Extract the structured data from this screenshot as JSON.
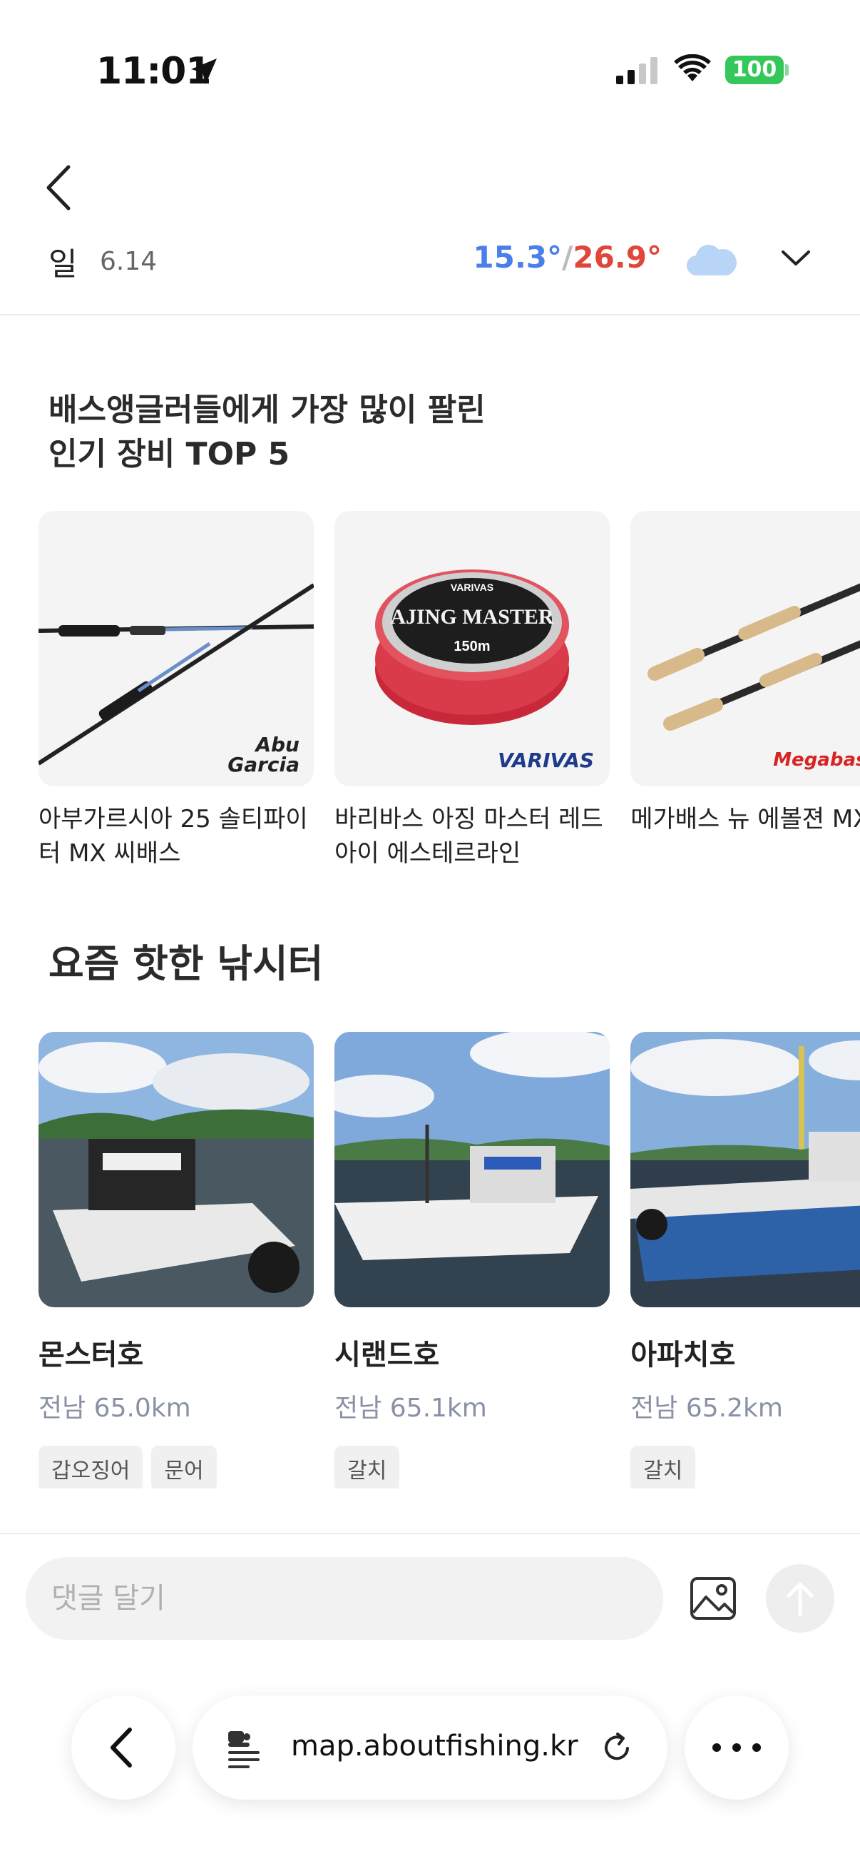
{
  "status_bar": {
    "time": "11:01",
    "battery": "100"
  },
  "weather": {
    "day": "일",
    "date": "6.14",
    "temp_low": "15.3°",
    "temp_separator": "/",
    "temp_high": "26.9°",
    "condition_icon": "cloud-icon"
  },
  "gear_section": {
    "title_line1": "배스앵글러들에게 가장 많이 팔린",
    "title_line2": "인기 장비 TOP 5",
    "items": [
      {
        "title": "아부가르시아 25 솔티파이터 MX 씨배스",
        "brand": "Abu Garcia"
      },
      {
        "title": "바리바스 아징 마스터 레드아이 에스테르라인",
        "brand": "VARIVAS",
        "product_text": "AJING MASTER",
        "spool_text": "150m"
      },
      {
        "title": "메가배스 뉴 에볼젼 MX-",
        "brand": "Megabass"
      }
    ]
  },
  "spot_section": {
    "title": "요즘 핫한 낚시터",
    "items": [
      {
        "name": "몬스터호",
        "distance": "전남 65.0km",
        "tags": [
          "갑오징어",
          "문어"
        ]
      },
      {
        "name": "시랜드호",
        "distance": "전남 65.1km",
        "tags": [
          "갈치"
        ]
      },
      {
        "name": "아파치호",
        "distance": "전남 65.2km",
        "tags": [
          "갈치"
        ]
      }
    ]
  },
  "comment_bar": {
    "placeholder": "댓글 달기"
  },
  "browser": {
    "url": "map.aboutfishing.kr"
  },
  "colors": {
    "temp_low": "#4a7ee8",
    "temp_high": "#e0463a",
    "battery": "#34c759",
    "distance": "#8a91a6"
  }
}
